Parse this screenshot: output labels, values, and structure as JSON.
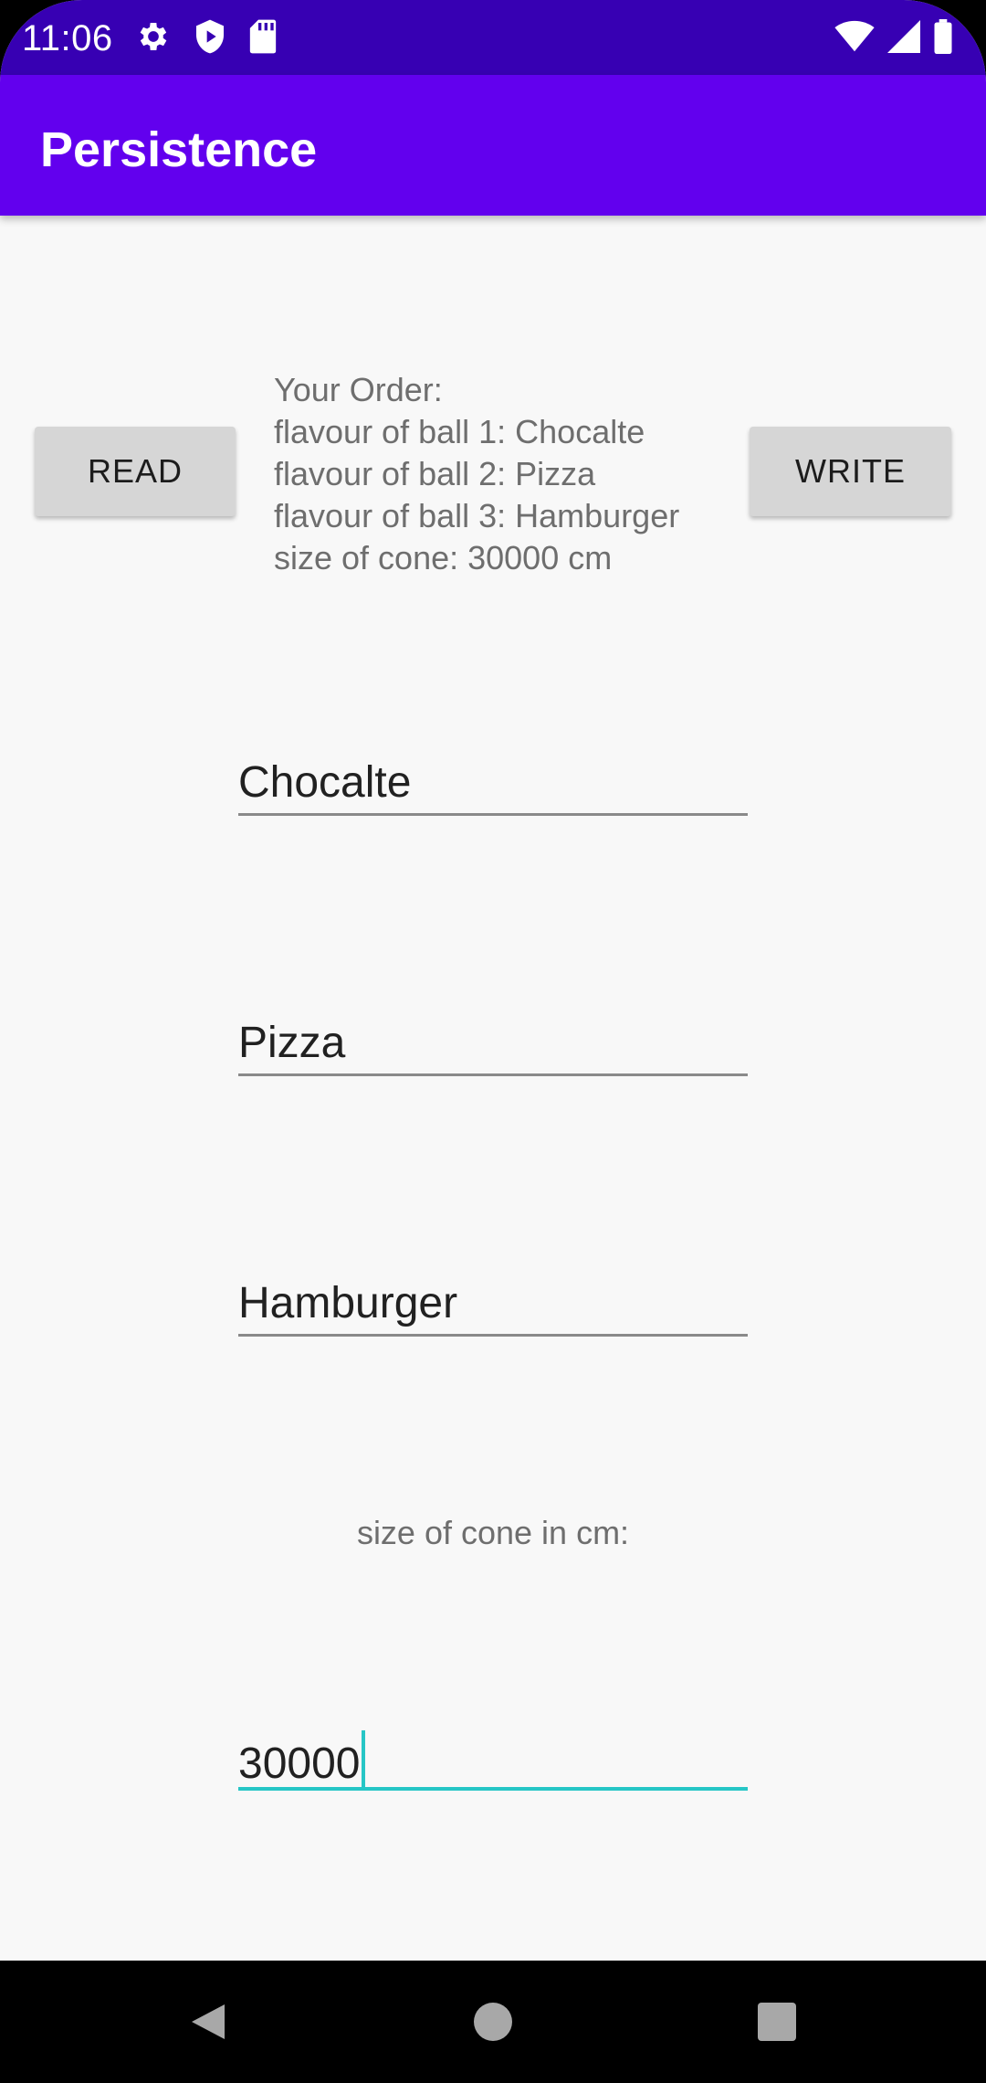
{
  "status_bar": {
    "time": "11:06",
    "left_icons": [
      "gear-icon",
      "shield-play-icon",
      "sd-card-icon"
    ],
    "right_icons": [
      "wifi-icon",
      "cellular-signal-icon",
      "battery-icon"
    ]
  },
  "app_bar": {
    "title": "Persistence",
    "color": "#6200ee",
    "status_color": "#3700b3"
  },
  "buttons": {
    "read": "READ",
    "write": "WRITE"
  },
  "order_summary": {
    "lines": [
      "Your Order:",
      "flavour of ball 1: Chocalte",
      "flavour of ball 2: Pizza",
      "flavour of ball 3: Hamburger",
      "size of cone: 30000 cm"
    ]
  },
  "inputs": {
    "ball1": "Chocalte",
    "ball2": "Pizza",
    "ball3": "Hamburger",
    "cone_label": "size of cone in cm:",
    "cone_size": "30000"
  },
  "colors": {
    "accent": "#26c6c6",
    "background": "#f8f8f8"
  },
  "nav_bar": {
    "icons": [
      "back-icon",
      "home-icon",
      "recents-icon"
    ]
  }
}
